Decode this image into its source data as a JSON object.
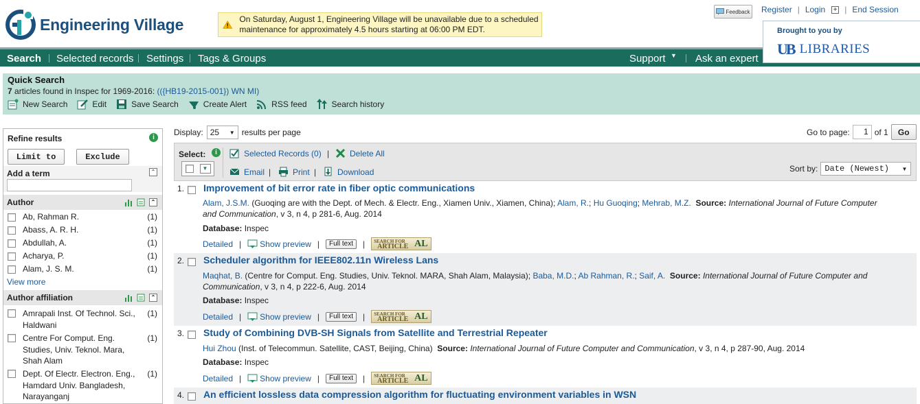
{
  "header": {
    "logo_text": "Engineering Village",
    "notice": "On Saturday, August 1, Engineering Village will be unavailable due to a scheduled maintenance for approximately 4.5 hours starting at 06:00 PM EDT.",
    "feedback_label": "Feedback",
    "register": "Register",
    "login": "Login",
    "end_session": "End Session",
    "brought": "Brought to you by",
    "library": "LIBRARIES",
    "ub": "UB"
  },
  "nav": {
    "search": "Search",
    "selected": "Selected records",
    "settings": "Settings",
    "tags": "Tags & Groups",
    "support": "Support",
    "ask": "Ask an expert"
  },
  "quick": {
    "title": "Quick Search",
    "count": "7",
    "found_text": "articles found in Inspec for 1969-2016:",
    "query": "(({HB19-2015-001}) WN MI)",
    "actions": [
      "New Search",
      "Edit",
      "Save Search",
      "Create Alert",
      "RSS feed",
      "Search history"
    ]
  },
  "sidebar": {
    "refine": "Refine results",
    "limit": "Limit to",
    "exclude": "Exclude",
    "add_term": "Add a term",
    "author_h": "Author",
    "authors": [
      {
        "name": "Ab, Rahman R.",
        "count": "(1)"
      },
      {
        "name": "Abass, A. R. H.",
        "count": "(1)"
      },
      {
        "name": "Abdullah, A.",
        "count": "(1)"
      },
      {
        "name": "Acharya, P.",
        "count": "(1)"
      },
      {
        "name": "Alam, J. S. M.",
        "count": "(1)"
      }
    ],
    "view_more": "View more",
    "affil_h": "Author affiliation",
    "affiliations": [
      {
        "name": "Amrapali Inst. Of Technol. Sci., Haldwani",
        "count": "(1)"
      },
      {
        "name": "Centre For Comput. Eng. Studies, Univ. Teknol. Mara, Shah Alam",
        "count": "(1)"
      },
      {
        "name": "Dept. Of Electr. Electron. Eng., Hamdard Univ. Bangladesh, Narayanganj",
        "count": "(1)"
      }
    ]
  },
  "results": {
    "display_label": "Display:",
    "display_value": "25",
    "per_page": "results per page",
    "goto_label": "Go to page:",
    "page": "1",
    "of": "of 1",
    "go": "Go",
    "select_label": "Select:",
    "selected_records": "Selected Records (0)",
    "delete_all": "Delete All",
    "email": "Email",
    "print": "Print",
    "download": "Download",
    "sort_label": "Sort by:",
    "sort_value": "Date (Newest)",
    "detailed": "Detailed",
    "show_preview": "Show preview",
    "full_text": "Full text",
    "db_label": "Database:",
    "source_label": "Source:",
    "sfa_top": "SEARCH FOR",
    "sfa_main": "ARTICLE",
    "sfa_logo": "AL",
    "records": [
      {
        "num": "1.",
        "title": "Improvement of bit error rate in fiber optic communications",
        "first_author": "Alam, J.S.M.",
        "affil": " (Guoqing are with the Dept. of Mech. & Electr. Eng., Xiamen Univ., Xiamen, China); ",
        "coauthors": [
          "Alam, R.",
          "Hu Guoqing",
          "Mehrab, M.Z."
        ],
        "journal": "International Journal of Future Computer and Communication",
        "details": ", v 3, n 4, p 281-6, Aug. 2014",
        "database": "Inspec"
      },
      {
        "num": "2.",
        "title": "Scheduler algorithm for IEEE802.11n Wireless Lans",
        "first_author": "Maqhat, B.",
        "affil": " (Centre for Comput. Eng. Studies, Univ. Teknol. MARA, Shah Alam, Malaysia); ",
        "coauthors": [
          "Baba, M.D.",
          "Ab Rahman, R.",
          "Saif, A."
        ],
        "journal": "International Journal of Future Computer and Communication",
        "details": ", v 3, n 4, p 222-6, Aug. 2014",
        "database": "Inspec"
      },
      {
        "num": "3.",
        "title": "Study of Combining DVB-SH Signals from Satellite and Terrestrial Repeater",
        "first_author": "Hui Zhou",
        "affil": " (Inst. of Telecommun. Satellite, CAST, Beijing, China) ",
        "coauthors": [],
        "journal": "International Journal of Future Computer and Communication",
        "details": ", v 3, n 4, p 287-90, Aug. 2014",
        "database": "Inspec"
      },
      {
        "num": "4.",
        "title": "An efficient lossless data compression algorithm for fluctuating environment variables in WSN"
      }
    ]
  },
  "colors": {
    "nav_bg": "#1a6c5c",
    "quick_bg": "#bfe0d6",
    "link": "#1a5a99",
    "logo_blue": "#1d4f7c"
  }
}
